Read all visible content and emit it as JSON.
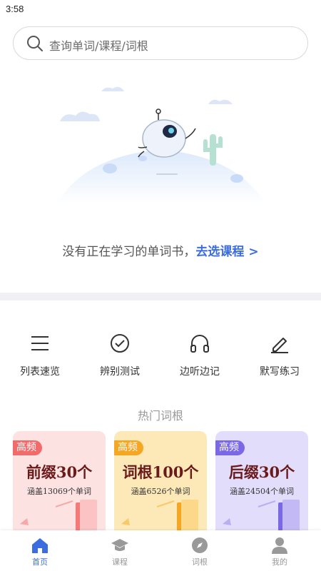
{
  "status_bar": {
    "time": "3:58"
  },
  "search": {
    "placeholder": "查询单词/课程/词根",
    "icon": "search-icon"
  },
  "empty_state": {
    "message": "没有正在学习的单词书，",
    "link": "去选课程 >"
  },
  "tools": [
    {
      "label": "列表速览",
      "icon": "list-icon"
    },
    {
      "label": "辨别测试",
      "icon": "check-circle-icon"
    },
    {
      "label": "边听边记",
      "icon": "headphones-icon"
    },
    {
      "label": "默写练习",
      "icon": "pencil-icon"
    }
  ],
  "hot_section": {
    "title": "热门词根"
  },
  "cards": [
    {
      "tag": "高频",
      "title": "前缀30个",
      "subtitle": "涵盖13069个单词",
      "color": "#f26b6b",
      "bg": "#fde2e2"
    },
    {
      "tag": "高频",
      "title": "词根100个",
      "subtitle": "涵盖6526个单词",
      "color": "#f5a623",
      "bg": "#fde9b8"
    },
    {
      "tag": "高频",
      "title": "后缀30个",
      "subtitle": "涵盖24504个单词",
      "color": "#7a68e6",
      "bg": "#e2ddfb"
    }
  ],
  "tab_bar": [
    {
      "label": "首页",
      "icon": "home-icon",
      "active": true
    },
    {
      "label": "课程",
      "icon": "graduation-cap-icon",
      "active": false
    },
    {
      "label": "词根",
      "icon": "compass-icon",
      "active": false
    },
    {
      "label": "我的",
      "icon": "user-icon",
      "active": false
    }
  ],
  "colors": {
    "accent": "#3b6de0",
    "divider": "#f1f1f3"
  }
}
